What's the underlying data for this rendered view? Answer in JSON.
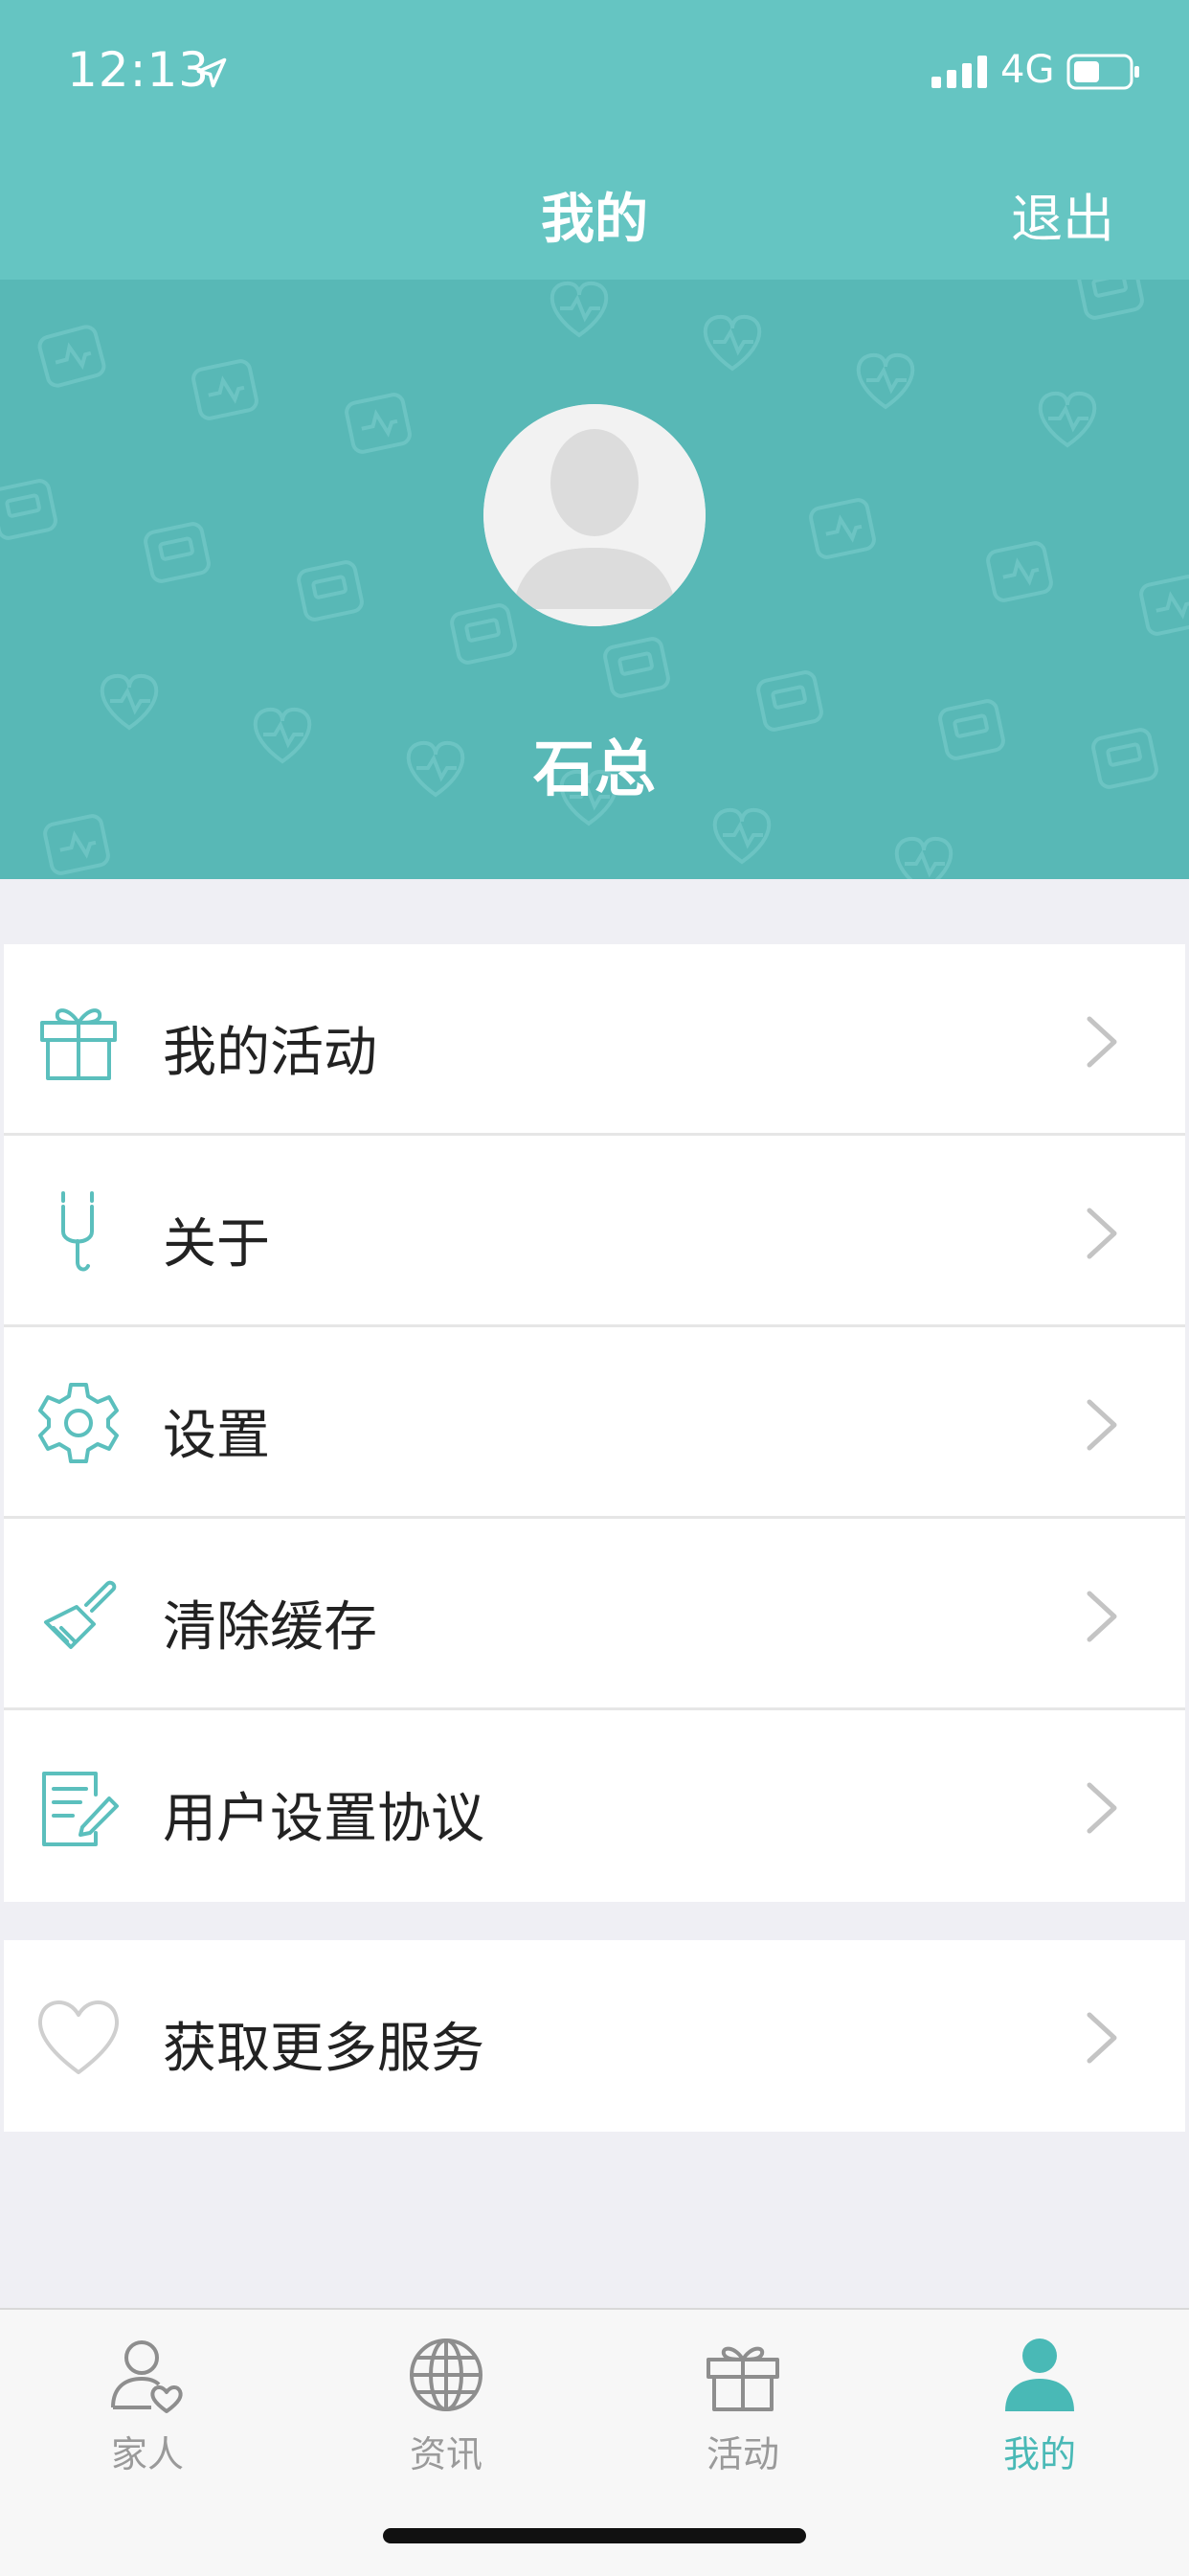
{
  "status_bar": {
    "time": "12:13",
    "network": "4G"
  },
  "nav": {
    "title": "我的",
    "logout_label": "退出"
  },
  "profile": {
    "name": "石总"
  },
  "menu": {
    "group1": [
      {
        "label": "我的活动",
        "icon": "gift-icon"
      },
      {
        "label": "关于",
        "icon": "stethoscope-icon"
      },
      {
        "label": "设置",
        "icon": "gear-icon"
      },
      {
        "label": "清除缓存",
        "icon": "brush-icon"
      },
      {
        "label": "用户设置协议",
        "icon": "document-edit-icon"
      }
    ],
    "group2": [
      {
        "label": "获取更多服务",
        "icon": "heart-icon"
      }
    ]
  },
  "tabs": [
    {
      "label": "家人",
      "icon": "person-heart-icon",
      "active": false
    },
    {
      "label": "资讯",
      "icon": "globe-icon",
      "active": false
    },
    {
      "label": "活动",
      "icon": "gift-icon",
      "active": false
    },
    {
      "label": "我的",
      "icon": "person-icon",
      "active": true
    }
  ],
  "colors": {
    "header": "#65c5c2",
    "banner": "#58b8b6",
    "accent": "#49b9b6",
    "icon_teal": "#5bbfbd",
    "background": "#efeff4"
  }
}
